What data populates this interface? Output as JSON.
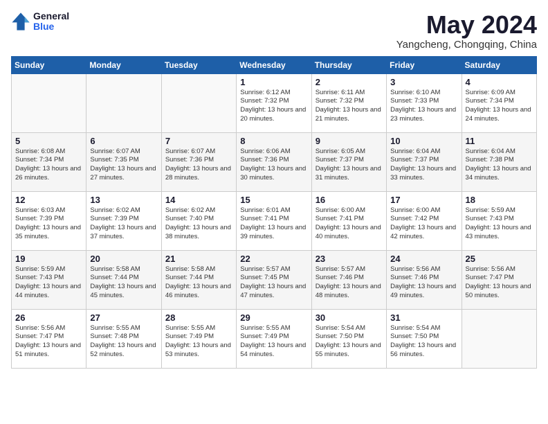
{
  "logo": {
    "general": "General",
    "blue": "Blue"
  },
  "title": {
    "month_year": "May 2024",
    "location": "Yangcheng, Chongqing, China"
  },
  "days_of_week": [
    "Sunday",
    "Monday",
    "Tuesday",
    "Wednesday",
    "Thursday",
    "Friday",
    "Saturday"
  ],
  "weeks": [
    [
      {
        "day": null
      },
      {
        "day": null
      },
      {
        "day": null
      },
      {
        "day": "1",
        "sunrise": "6:12 AM",
        "sunset": "7:32 PM",
        "daylight": "13 hours and 20 minutes."
      },
      {
        "day": "2",
        "sunrise": "6:11 AM",
        "sunset": "7:32 PM",
        "daylight": "13 hours and 21 minutes."
      },
      {
        "day": "3",
        "sunrise": "6:10 AM",
        "sunset": "7:33 PM",
        "daylight": "13 hours and 23 minutes."
      },
      {
        "day": "4",
        "sunrise": "6:09 AM",
        "sunset": "7:34 PM",
        "daylight": "13 hours and 24 minutes."
      }
    ],
    [
      {
        "day": "5",
        "sunrise": "6:08 AM",
        "sunset": "7:34 PM",
        "daylight": "13 hours and 26 minutes."
      },
      {
        "day": "6",
        "sunrise": "6:07 AM",
        "sunset": "7:35 PM",
        "daylight": "13 hours and 27 minutes."
      },
      {
        "day": "7",
        "sunrise": "6:07 AM",
        "sunset": "7:36 PM",
        "daylight": "13 hours and 28 minutes."
      },
      {
        "day": "8",
        "sunrise": "6:06 AM",
        "sunset": "7:36 PM",
        "daylight": "13 hours and 30 minutes."
      },
      {
        "day": "9",
        "sunrise": "6:05 AM",
        "sunset": "7:37 PM",
        "daylight": "13 hours and 31 minutes."
      },
      {
        "day": "10",
        "sunrise": "6:04 AM",
        "sunset": "7:37 PM",
        "daylight": "13 hours and 33 minutes."
      },
      {
        "day": "11",
        "sunrise": "6:04 AM",
        "sunset": "7:38 PM",
        "daylight": "13 hours and 34 minutes."
      }
    ],
    [
      {
        "day": "12",
        "sunrise": "6:03 AM",
        "sunset": "7:39 PM",
        "daylight": "13 hours and 35 minutes."
      },
      {
        "day": "13",
        "sunrise": "6:02 AM",
        "sunset": "7:39 PM",
        "daylight": "13 hours and 37 minutes."
      },
      {
        "day": "14",
        "sunrise": "6:02 AM",
        "sunset": "7:40 PM",
        "daylight": "13 hours and 38 minutes."
      },
      {
        "day": "15",
        "sunrise": "6:01 AM",
        "sunset": "7:41 PM",
        "daylight": "13 hours and 39 minutes."
      },
      {
        "day": "16",
        "sunrise": "6:00 AM",
        "sunset": "7:41 PM",
        "daylight": "13 hours and 40 minutes."
      },
      {
        "day": "17",
        "sunrise": "6:00 AM",
        "sunset": "7:42 PM",
        "daylight": "13 hours and 42 minutes."
      },
      {
        "day": "18",
        "sunrise": "5:59 AM",
        "sunset": "7:43 PM",
        "daylight": "13 hours and 43 minutes."
      }
    ],
    [
      {
        "day": "19",
        "sunrise": "5:59 AM",
        "sunset": "7:43 PM",
        "daylight": "13 hours and 44 minutes."
      },
      {
        "day": "20",
        "sunrise": "5:58 AM",
        "sunset": "7:44 PM",
        "daylight": "13 hours and 45 minutes."
      },
      {
        "day": "21",
        "sunrise": "5:58 AM",
        "sunset": "7:44 PM",
        "daylight": "13 hours and 46 minutes."
      },
      {
        "day": "22",
        "sunrise": "5:57 AM",
        "sunset": "7:45 PM",
        "daylight": "13 hours and 47 minutes."
      },
      {
        "day": "23",
        "sunrise": "5:57 AM",
        "sunset": "7:46 PM",
        "daylight": "13 hours and 48 minutes."
      },
      {
        "day": "24",
        "sunrise": "5:56 AM",
        "sunset": "7:46 PM",
        "daylight": "13 hours and 49 minutes."
      },
      {
        "day": "25",
        "sunrise": "5:56 AM",
        "sunset": "7:47 PM",
        "daylight": "13 hours and 50 minutes."
      }
    ],
    [
      {
        "day": "26",
        "sunrise": "5:56 AM",
        "sunset": "7:47 PM",
        "daylight": "13 hours and 51 minutes."
      },
      {
        "day": "27",
        "sunrise": "5:55 AM",
        "sunset": "7:48 PM",
        "daylight": "13 hours and 52 minutes."
      },
      {
        "day": "28",
        "sunrise": "5:55 AM",
        "sunset": "7:49 PM",
        "daylight": "13 hours and 53 minutes."
      },
      {
        "day": "29",
        "sunrise": "5:55 AM",
        "sunset": "7:49 PM",
        "daylight": "13 hours and 54 minutes."
      },
      {
        "day": "30",
        "sunrise": "5:54 AM",
        "sunset": "7:50 PM",
        "daylight": "13 hours and 55 minutes."
      },
      {
        "day": "31",
        "sunrise": "5:54 AM",
        "sunset": "7:50 PM",
        "daylight": "13 hours and 56 minutes."
      },
      {
        "day": null
      }
    ]
  ],
  "labels": {
    "sunrise": "Sunrise:",
    "sunset": "Sunset:",
    "daylight": "Daylight:"
  }
}
